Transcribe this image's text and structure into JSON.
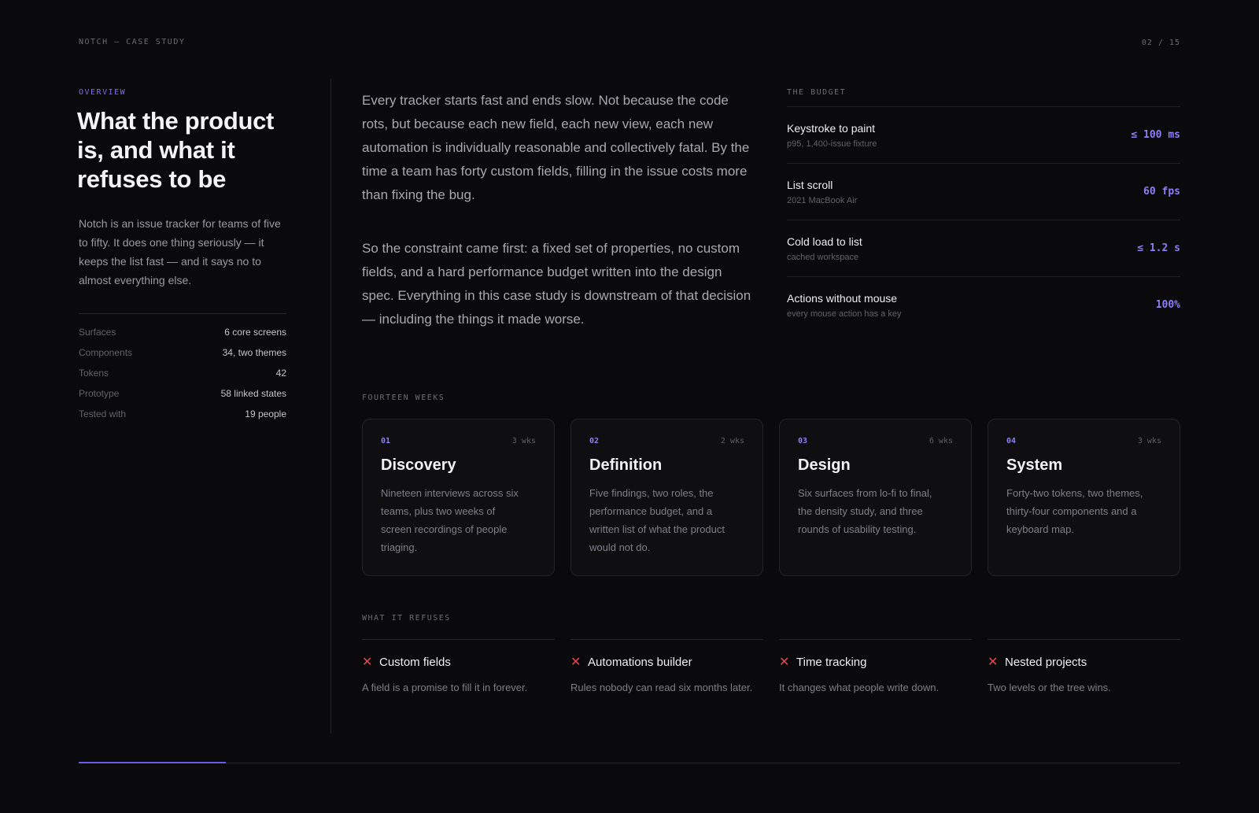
{
  "header": {
    "brand": "NOTCH — CASE STUDY",
    "page": "02 / 15"
  },
  "overview": {
    "eyebrow": "OVERVIEW",
    "title": "What the product is, and what it refuses to be",
    "intro": "Notch is an issue tracker for teams of five to fifty. It does one thing seriously — it keeps the list fast — and it says no to almost everything else.",
    "facts": [
      {
        "label": "Surfaces",
        "value": "6 core screens"
      },
      {
        "label": "Components",
        "value": "34, two themes"
      },
      {
        "label": "Tokens",
        "value": "42"
      },
      {
        "label": "Prototype",
        "value": "58 linked states"
      },
      {
        "label": "Tested with",
        "value": "19 people"
      }
    ]
  },
  "essay": [
    "Every tracker starts fast and ends slow. Not because the code rots, but because each new field, each new view, each new automation is individually reasonable and collectively fatal. By the time a team has forty custom fields, filling in the issue costs more than fixing the bug.",
    "So the constraint came first: a fixed set of properties, no custom fields, and a hard performance budget written into the design spec. Everything in this case study is downstream of that decision — including the things it made worse."
  ],
  "budget": {
    "label": "THE BUDGET",
    "rows": [
      {
        "name": "Keystroke to paint",
        "sub": "p95, 1,400-issue fixture",
        "value": "≤ 100 ms"
      },
      {
        "name": "List scroll",
        "sub": "2021 MacBook Air",
        "value": "60 fps"
      },
      {
        "name": "Cold load to list",
        "sub": "cached workspace",
        "value": "≤ 1.2 s"
      },
      {
        "name": "Actions without mouse",
        "sub": "every mouse action has a key",
        "value": "100%"
      }
    ]
  },
  "timeline": {
    "label": "FOURTEEN WEEKS",
    "phases": [
      {
        "num": "01",
        "duration": "3 wks",
        "title": "Discovery",
        "desc": "Nineteen interviews across six teams, plus two weeks of screen recordings of people triaging."
      },
      {
        "num": "02",
        "duration": "2 wks",
        "title": "Definition",
        "desc": "Five findings, two roles, the performance budget, and a written list of what the product would not do."
      },
      {
        "num": "03",
        "duration": "6 wks",
        "title": "Design",
        "desc": "Six surfaces from lo-fi to final, the density study, and three rounds of usability testing."
      },
      {
        "num": "04",
        "duration": "3 wks",
        "title": "System",
        "desc": "Forty-two tokens, two themes, thirty-four components and a keyboard map."
      }
    ]
  },
  "refuses": {
    "label": "WHAT IT REFUSES",
    "items": [
      {
        "icon": "x-icon",
        "title": "Custom fields",
        "desc": "A field is a promise to fill it in forever."
      },
      {
        "icon": "x-icon",
        "title": "Automations builder",
        "desc": "Rules nobody can read six months later."
      },
      {
        "icon": "x-icon",
        "title": "Time tracking",
        "desc": "It changes what people write down."
      },
      {
        "icon": "x-icon",
        "title": "Nested projects",
        "desc": "Two levels or the tree wins."
      }
    ]
  },
  "progress": {
    "fraction": 0.1333
  },
  "colors": {
    "accent": "#7c6cf0",
    "danger": "#e5484d",
    "background": "#0a0a0c"
  }
}
